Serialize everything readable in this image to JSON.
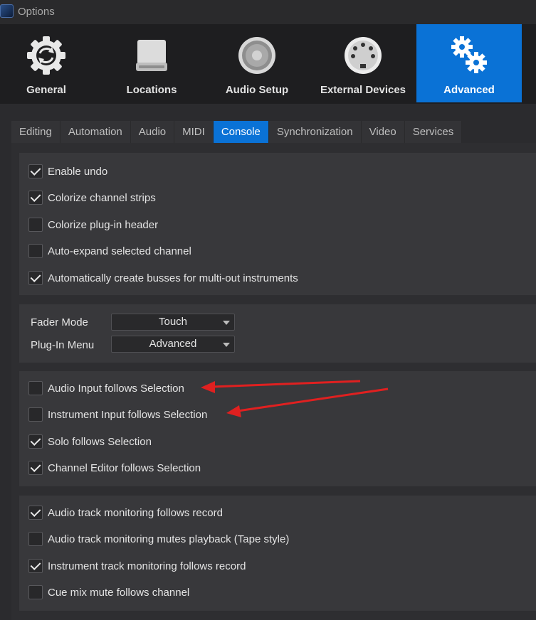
{
  "window": {
    "title": "Options"
  },
  "categories": [
    {
      "label": "General",
      "icon": "gear-refresh-icon"
    },
    {
      "label": "Locations",
      "icon": "drive-icon"
    },
    {
      "label": "Audio Setup",
      "icon": "speaker-icon"
    },
    {
      "label": "External Devices",
      "icon": "midi-connector-icon"
    },
    {
      "label": "Advanced",
      "icon": "gears-icon",
      "active": true
    }
  ],
  "tabs": [
    "Editing",
    "Automation",
    "Audio",
    "MIDI",
    "Console",
    "Synchronization",
    "Video",
    "Services"
  ],
  "active_tab": "Console",
  "group1": [
    {
      "label": "Enable undo",
      "checked": true
    },
    {
      "label": "Colorize channel strips",
      "checked": true
    },
    {
      "label": "Colorize plug-in header",
      "checked": false
    },
    {
      "label": "Auto-expand selected channel",
      "checked": false
    },
    {
      "label": "Automatically create busses for multi-out instruments",
      "checked": true
    }
  ],
  "selects": {
    "fader_mode": {
      "label": "Fader Mode",
      "value": "Touch"
    },
    "plugin_menu": {
      "label": "Plug-In Menu",
      "value": "Advanced"
    }
  },
  "group2": [
    {
      "label": "Audio Input follows Selection",
      "checked": false
    },
    {
      "label": "Instrument Input follows Selection",
      "checked": false
    },
    {
      "label": "Solo follows Selection",
      "checked": true
    },
    {
      "label": "Channel Editor follows Selection",
      "checked": true
    }
  ],
  "group3": [
    {
      "label": "Audio track monitoring follows record",
      "checked": true
    },
    {
      "label": "Audio track monitoring mutes playback (Tape style)",
      "checked": false
    },
    {
      "label": "Instrument track monitoring follows record",
      "checked": true
    },
    {
      "label": "Cue mix mute follows channel",
      "checked": false
    }
  ],
  "colors": {
    "accent": "#0a72d6",
    "annotation_arrow": "#e02020"
  }
}
